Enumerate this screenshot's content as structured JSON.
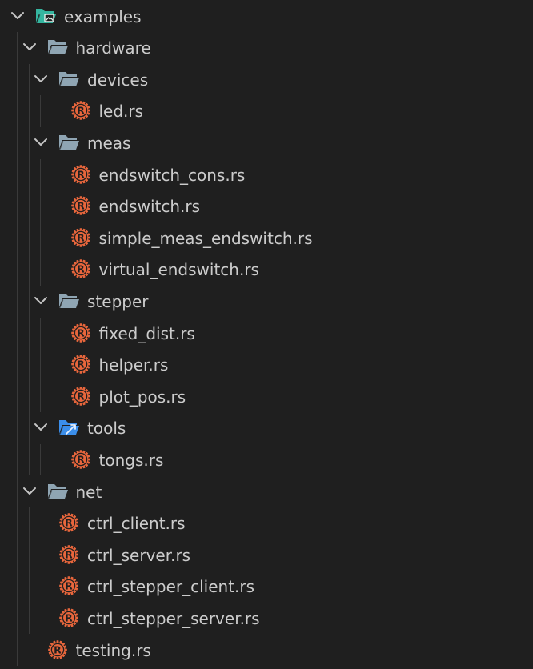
{
  "colors": {
    "background": "#1f1f1f",
    "text": "#cccccc",
    "chevron": "#c5c5c5",
    "folder": "#8fa5b3",
    "examples_folder": "#35b6a0",
    "tools_folder": "#3b8eea",
    "rust_icon": "#e8663c"
  },
  "tree": [
    {
      "label": "examples",
      "kind": "folder-open",
      "icon": "examples-folder-icon",
      "depth": 0
    },
    {
      "label": "hardware",
      "kind": "folder-open",
      "icon": "folder-open-icon",
      "depth": 1
    },
    {
      "label": "devices",
      "kind": "folder-open",
      "icon": "folder-open-icon",
      "depth": 2
    },
    {
      "label": "led.rs",
      "kind": "file",
      "icon": "rust-file-icon",
      "depth": 3
    },
    {
      "label": "meas",
      "kind": "folder-open",
      "icon": "folder-open-icon",
      "depth": 2
    },
    {
      "label": "endswitch_cons.rs",
      "kind": "file",
      "icon": "rust-file-icon",
      "depth": 3
    },
    {
      "label": "endswitch.rs",
      "kind": "file",
      "icon": "rust-file-icon",
      "depth": 3
    },
    {
      "label": "simple_meas_endswitch.rs",
      "kind": "file",
      "icon": "rust-file-icon",
      "depth": 3
    },
    {
      "label": "virtual_endswitch.rs",
      "kind": "file",
      "icon": "rust-file-icon",
      "depth": 3
    },
    {
      "label": "stepper",
      "kind": "folder-open",
      "icon": "folder-open-icon",
      "depth": 2
    },
    {
      "label": "fixed_dist.rs",
      "kind": "file",
      "icon": "rust-file-icon",
      "depth": 3
    },
    {
      "label": "helper.rs",
      "kind": "file",
      "icon": "rust-file-icon",
      "depth": 3
    },
    {
      "label": "plot_pos.rs",
      "kind": "file",
      "icon": "rust-file-icon",
      "depth": 3
    },
    {
      "label": "tools",
      "kind": "folder-open",
      "icon": "tools-folder-icon",
      "depth": 2
    },
    {
      "label": "tongs.rs",
      "kind": "file",
      "icon": "rust-file-icon",
      "depth": 3
    },
    {
      "label": "net",
      "kind": "folder-open",
      "icon": "folder-open-icon",
      "depth": 1
    },
    {
      "label": "ctrl_client.rs",
      "kind": "file",
      "icon": "rust-file-icon",
      "depth": 2
    },
    {
      "label": "ctrl_server.rs",
      "kind": "file",
      "icon": "rust-file-icon",
      "depth": 2
    },
    {
      "label": "ctrl_stepper_client.rs",
      "kind": "file",
      "icon": "rust-file-icon",
      "depth": 2
    },
    {
      "label": "ctrl_stepper_server.rs",
      "kind": "file",
      "icon": "rust-file-icon",
      "depth": 2
    },
    {
      "label": "testing.rs",
      "kind": "file",
      "icon": "rust-file-icon",
      "depth": 1
    }
  ]
}
